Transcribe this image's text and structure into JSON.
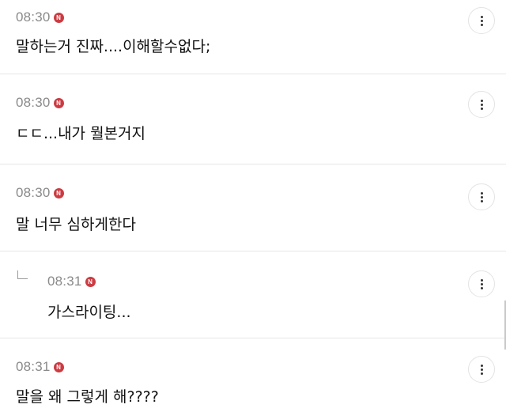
{
  "comments": [
    {
      "time": "08:30",
      "badge": "N",
      "text": "말하는거 진짜....이해할수없다;",
      "reply": false
    },
    {
      "time": "08:30",
      "badge": "N",
      "text": "ㄷㄷ...내가 뭘본거지",
      "reply": false
    },
    {
      "time": "08:30",
      "badge": "N",
      "text": "말 너무 심하게한다",
      "reply": false
    },
    {
      "time": "08:31",
      "badge": "N",
      "text": "가스라이팅...",
      "reply": true
    },
    {
      "time": "08:31",
      "badge": "N",
      "text": "말을 왜 그렇게 해????",
      "reply": false
    }
  ],
  "icons": {
    "more": "more-vertical-icon",
    "new": "new-badge-icon",
    "reply": "reply-arrow-icon"
  },
  "colors": {
    "badge": "#cc3b42",
    "time": "#8a8a8a",
    "divider": "#e6e6e6"
  }
}
